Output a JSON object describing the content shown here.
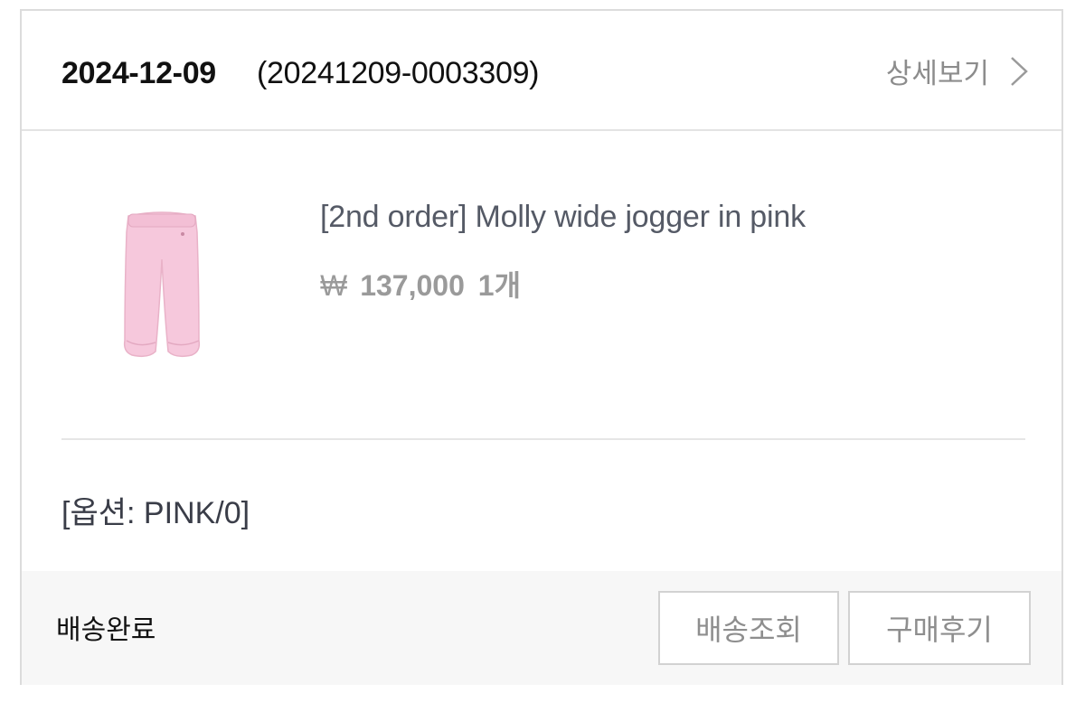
{
  "order": {
    "date": "2024-12-09",
    "number": "(20241209-0003309)",
    "detail_label": "상세보기",
    "detail_icon": "chevron-right-icon"
  },
  "product": {
    "name": "[2nd order] Molly wide jogger in pink",
    "currency_symbol": "₩",
    "price": "137,000",
    "quantity": "1개",
    "image": "pink-jogger-pants-thumbnail",
    "option": "[옵션: PINK/0]"
  },
  "footer": {
    "status": "배송완료",
    "track_button": "배송조회",
    "review_button": "구매후기"
  },
  "colors": {
    "border": "#dcdcdc",
    "footer_bg": "#f7f7f7",
    "muted_text": "#9a9a9a",
    "product_pink": "#f6c8dc"
  }
}
